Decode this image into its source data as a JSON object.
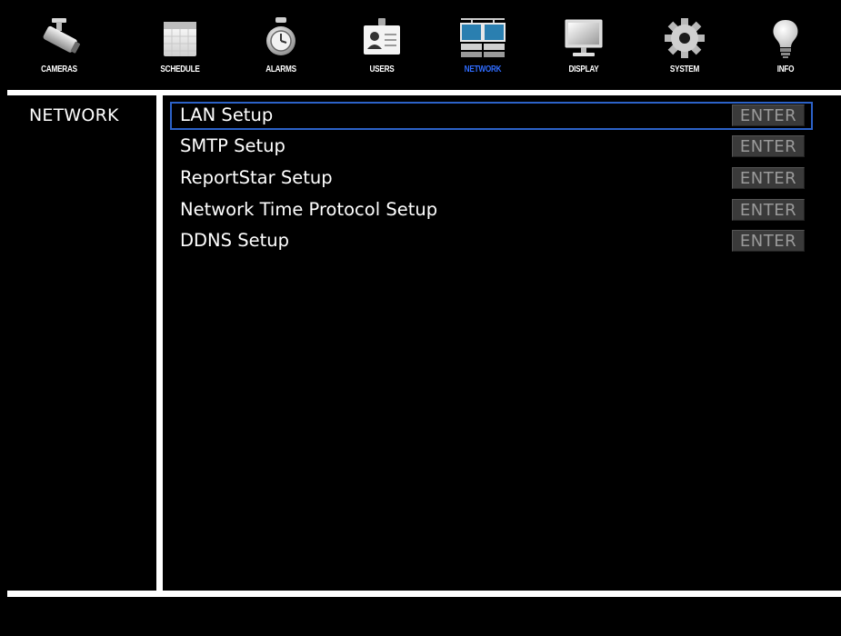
{
  "toolbar": {
    "items": [
      {
        "label": "CAMERAS",
        "icon": "camera-icon",
        "active": false
      },
      {
        "label": "SCHEDULE",
        "icon": "calendar-icon",
        "active": false
      },
      {
        "label": "ALARMS",
        "icon": "alarm-clock-icon",
        "active": false
      },
      {
        "label": "USERS",
        "icon": "user-badge-icon",
        "active": false
      },
      {
        "label": "NETWORK",
        "icon": "network-computers-icon",
        "active": true
      },
      {
        "label": "DISPLAY",
        "icon": "monitor-icon",
        "active": false
      },
      {
        "label": "SYSTEM",
        "icon": "gear-icon",
        "active": false
      },
      {
        "label": "INFO",
        "icon": "lightbulb-icon",
        "active": false
      }
    ],
    "active_color": "#2f6cff"
  },
  "section": {
    "title": "NETWORK"
  },
  "menu": {
    "items": [
      {
        "label": "LAN Setup",
        "button": "ENTER",
        "selected": true
      },
      {
        "label": "SMTP Setup",
        "button": "ENTER",
        "selected": false
      },
      {
        "label": "ReportStar Setup",
        "button": "ENTER",
        "selected": false
      },
      {
        "label": "Network Time Protocol Setup",
        "button": "ENTER",
        "selected": false
      },
      {
        "label": "DDNS Setup",
        "button": "ENTER",
        "selected": false
      }
    ],
    "selection_color": "#2c62c8"
  }
}
